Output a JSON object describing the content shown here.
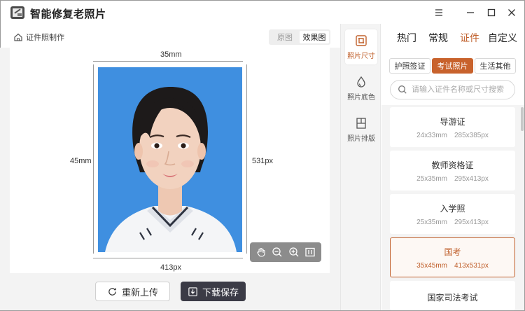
{
  "app": {
    "title": "智能修复老照片"
  },
  "window_controls": {
    "menu": "menu-icon",
    "minimize": "minimize-icon",
    "maximize": "maximize-icon",
    "close": "close-icon"
  },
  "breadcrumb": {
    "label": "证件照制作"
  },
  "view_toggle": {
    "original": "原图",
    "effect": "效果图",
    "active": "效果图"
  },
  "photo": {
    "width_mm": "35mm",
    "height_mm": "45mm",
    "width_px": "413px",
    "height_px": "531px",
    "background_color": "#3f8fe0"
  },
  "zoom_tools": [
    "hand-icon",
    "zoom-out-icon",
    "zoom-in-icon",
    "fit-icon"
  ],
  "actions": {
    "reupload": "重新上传",
    "save": "下载保存"
  },
  "tools": [
    {
      "label": "照片尺寸",
      "icon": "crop-icon",
      "active": true
    },
    {
      "label": "照片底色",
      "icon": "drop-icon",
      "active": false
    },
    {
      "label": "照片排版",
      "icon": "layout-icon",
      "active": false
    }
  ],
  "tabs": [
    {
      "label": "热门",
      "active": false
    },
    {
      "label": "常规",
      "active": false
    },
    {
      "label": "证件",
      "active": true
    },
    {
      "label": "自定义",
      "active": false
    }
  ],
  "subtabs": [
    {
      "label": "护照签证",
      "active": false
    },
    {
      "label": "考试照片",
      "active": true
    },
    {
      "label": "生活其他",
      "active": false
    }
  ],
  "search": {
    "placeholder": "请输入证件名称或尺寸搜索",
    "value": ""
  },
  "sizes": [
    {
      "name": "导游证",
      "mm": "24x33mm",
      "px": "285x385px",
      "selected": false
    },
    {
      "name": "教师资格证",
      "mm": "25x35mm",
      "px": "295x413px",
      "selected": false
    },
    {
      "name": "入学照",
      "mm": "25x35mm",
      "px": "295x413px",
      "selected": false
    },
    {
      "name": "国考",
      "mm": "35x45mm",
      "px": "413x531px",
      "selected": true
    },
    {
      "name": "国家司法考试",
      "mm": "",
      "px": "",
      "selected": false
    }
  ],
  "colors": {
    "accent": "#c0602c",
    "save_button": "#3b3b46",
    "photo_bg": "#3f8fe0"
  }
}
